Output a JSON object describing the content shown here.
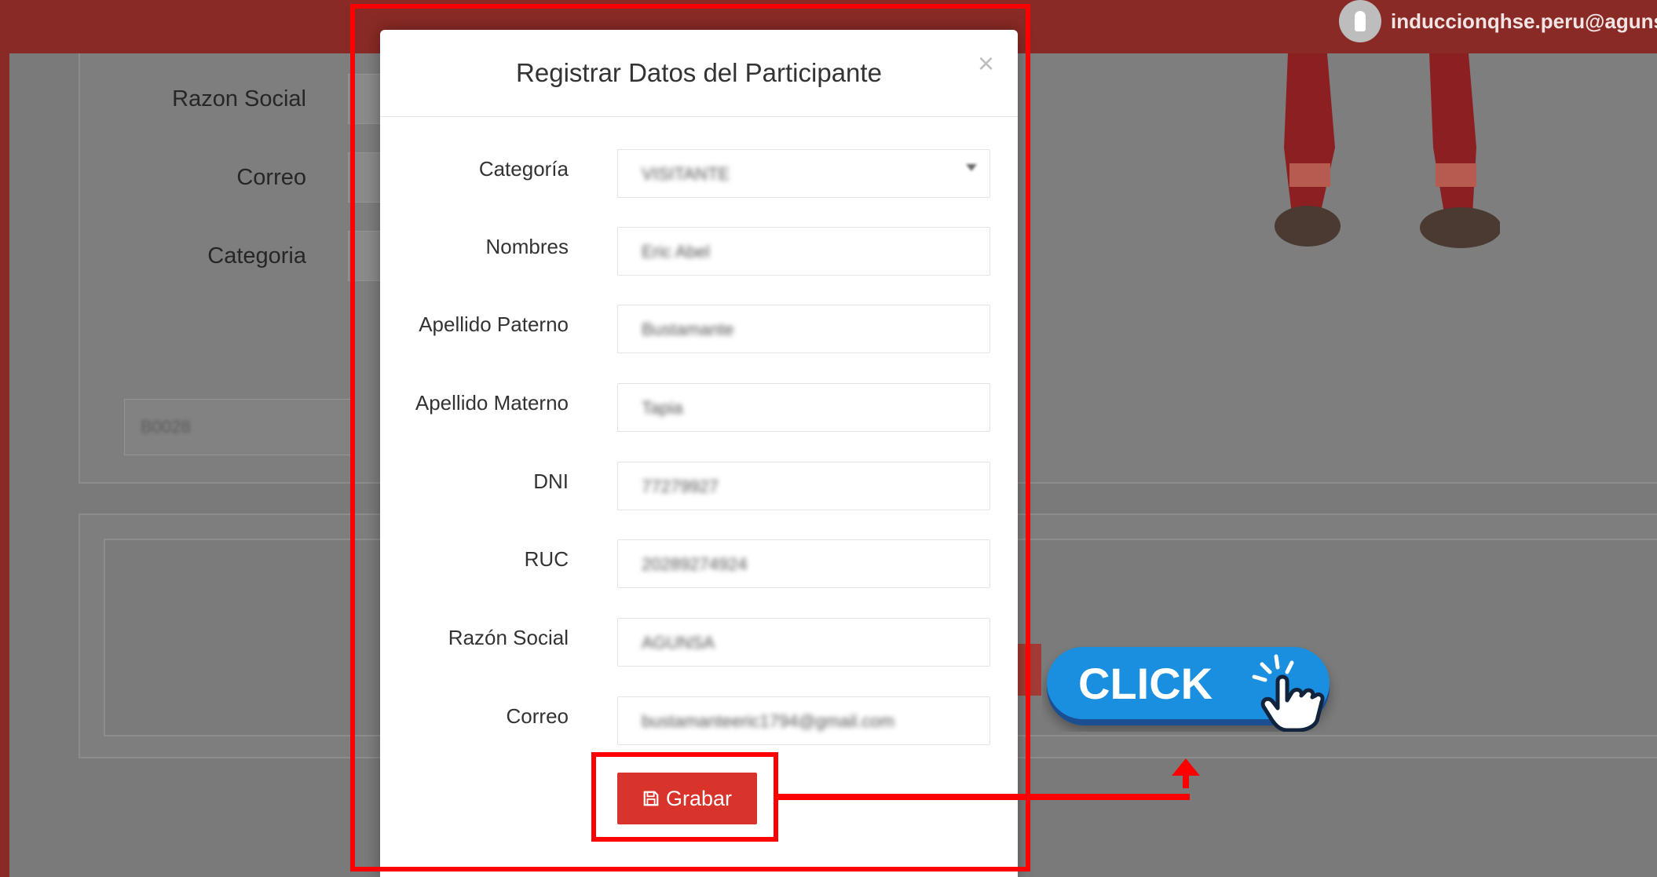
{
  "topbar": {
    "user_email": "induccionqhse.peru@aguns"
  },
  "background_form": {
    "labels": [
      "Razon Social",
      "Correo",
      "Categoria"
    ],
    "search_value": "B0028"
  },
  "modal": {
    "title": "Registrar Datos del Participante",
    "close_label": "×",
    "fields": [
      {
        "label": "Categoría",
        "value": "VISITANTE"
      },
      {
        "label": "Nombres",
        "value": "Eric Abel"
      },
      {
        "label": "Apellido Paterno",
        "value": "Bustamante"
      },
      {
        "label": "Apellido Materno",
        "value": "Tapia"
      },
      {
        "label": "DNI",
        "value": "77279927"
      },
      {
        "label": "RUC",
        "value": "20289274924"
      },
      {
        "label": "Razón Social",
        "value": "AGUNSA"
      },
      {
        "label": "Correo",
        "value": "bustamanteeric1794@gmail.com"
      }
    ],
    "save_label": "Grabar"
  },
  "annotation": {
    "click_text": "CLICK",
    "highlight_color": "#ff0000",
    "badge_color": "#1a8fe0"
  }
}
